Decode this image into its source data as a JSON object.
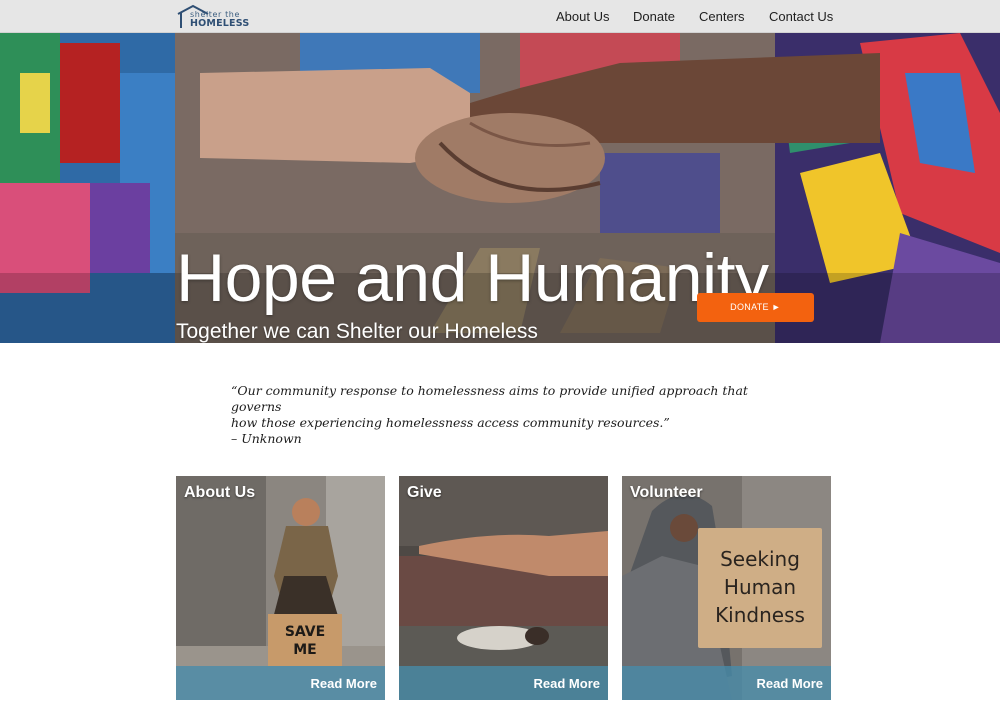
{
  "nav": {
    "logo_line1": "shelter the",
    "logo_line2": "HOMELESS",
    "links": [
      "About Us",
      "Donate",
      "Centers",
      "Contact Us"
    ]
  },
  "hero": {
    "title": "Hope and Humanity",
    "subtitle": "Together we can Shelter our Homeless",
    "donate_label": "DONATE ►"
  },
  "quote": {
    "line1": "“Our community response to homelessness aims to provide  unified approach that governs",
    "line2": "how those experiencing homelessness access community resources.”",
    "attribution": "– Unknown"
  },
  "cards": [
    {
      "title": "About Us",
      "link": "Read More",
      "sign_text": [
        "SAVE",
        "ME"
      ]
    },
    {
      "title": "Give",
      "link": "Read More"
    },
    {
      "title": "Volunteer",
      "link": "Read More",
      "sign_text": [
        "Seeking",
        "Human",
        "Kindness"
      ]
    }
  ],
  "colors": {
    "nav_bg": "#e6e6e6",
    "donate_button": "#f3620f",
    "card_footer": "#468caa",
    "logo": "#2f4f74"
  }
}
